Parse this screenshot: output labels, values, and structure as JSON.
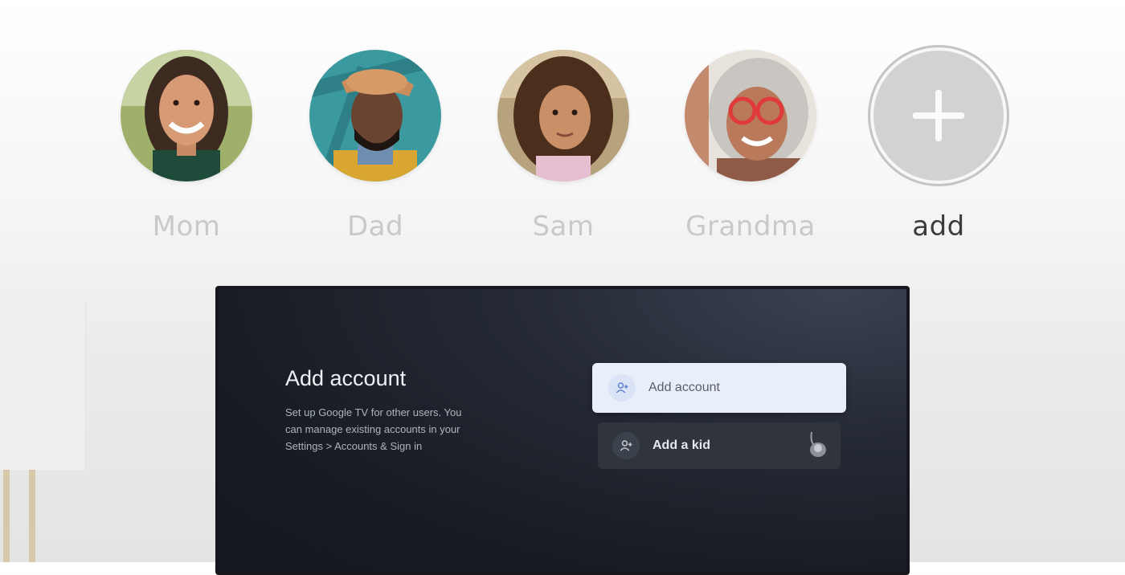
{
  "profiles": [
    {
      "name": "Mom"
    },
    {
      "name": "Dad"
    },
    {
      "name": "Sam"
    },
    {
      "name": "Grandma"
    }
  ],
  "add_profile": {
    "label": "add"
  },
  "tv": {
    "title": "Add account",
    "description": "Set up Google TV for other users. You can manage existing accounts in your Settings > Accounts & Sign in",
    "options": [
      {
        "label": "Add account",
        "icon": "add-person-icon",
        "focused": true
      },
      {
        "label": "Add a kid",
        "icon": "add-person-icon",
        "focused": false
      }
    ]
  },
  "colors": {
    "profile_name_inactive": "#c9c9c9",
    "profile_name_active": "#3b3b3b",
    "focused_option_bg": "#e9eefb",
    "option_bg": "#2f343d",
    "screen_bg": "#171b22"
  }
}
